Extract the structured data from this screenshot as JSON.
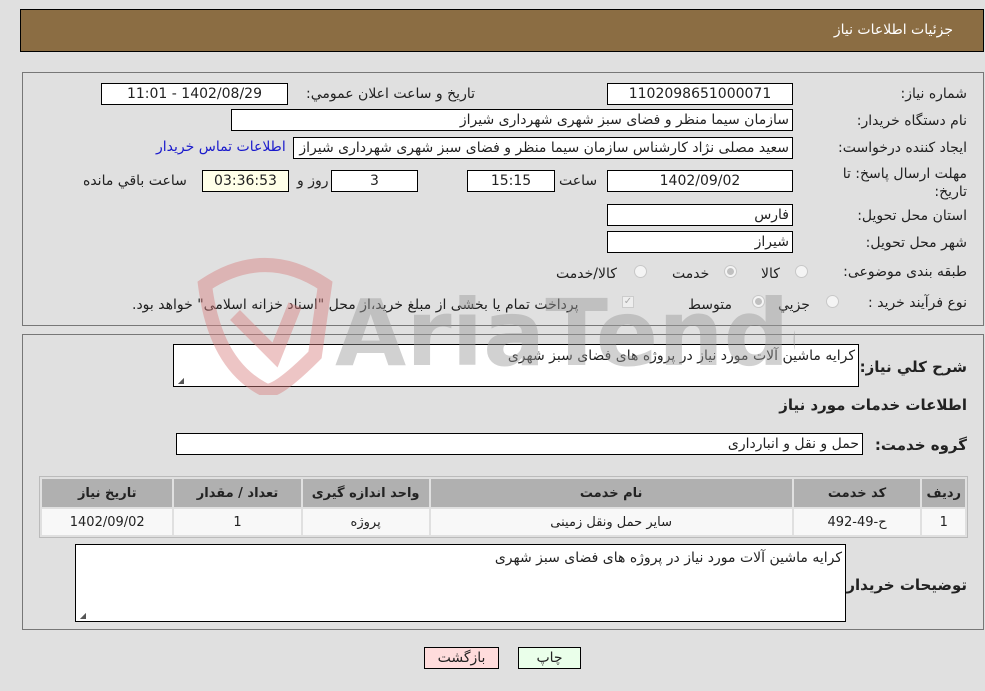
{
  "header": {
    "title": "جزئیات اطلاعات نیاز"
  },
  "form": {
    "need_number": {
      "label": "شماره نیاز:",
      "value": "1102098651000071"
    },
    "announce_datetime": {
      "label": "تاریخ و ساعت اعلان عمومي:",
      "value": "1402/08/29 - 11:01"
    },
    "buyer_org": {
      "label": "نام دستگاه خریدار:",
      "value": "سازمان سیما منظر و فضای سبز شهری شهرداری شیراز"
    },
    "requester": {
      "label": "ایجاد کننده درخواست:",
      "value": "سعید مصلی نژاد کارشناس سازمان سیما منظر و فضای سبز شهری شهرداری شیراز",
      "contact_link": "اطلاعات تماس خریدار"
    },
    "deadline": {
      "label": "مهلت ارسال پاسخ: تا تاریخ:",
      "date": "1402/09/02",
      "time_label": "ساعت",
      "time": "15:15",
      "days": "3",
      "days_label": "روز و",
      "remaining": "03:36:53",
      "remaining_label": "ساعت باقي مانده"
    },
    "province": {
      "label": "استان محل تحویل:",
      "value": "فارس"
    },
    "city": {
      "label": "شهر محل تحویل:",
      "value": "شیراز"
    },
    "category": {
      "label": "طبقه بندی موضوعی:",
      "options": [
        "کالا",
        "خدمت",
        "کالا/خدمت"
      ],
      "selected": "خدمت"
    },
    "purchase_type": {
      "label": "نوع فرآیند خرید :",
      "options": [
        "جزيي",
        "متوسط"
      ],
      "selected": "متوسط",
      "treasury_note": "پرداخت تمام یا بخشی از مبلغ خرید،از محل \"اسناد خزانه اسلامی\" خواهد بود."
    }
  },
  "summary": {
    "label": "شرح کلي نیاز:",
    "value": "کرایه ماشین آلات مورد نیاز در پروژه های فضای سبز شهری"
  },
  "services": {
    "section_title": "اطلاعات خدمات مورد نیاز",
    "group_label": "گروه خدمت:",
    "group_value": "حمل و نقل و انبارداری",
    "table": {
      "headers": [
        "ردیف",
        "کد خدمت",
        "نام خدمت",
        "واحد اندازه گیری",
        "تعداد / مقدار",
        "تاریخ نیاز"
      ],
      "rows": [
        [
          "1",
          "ح-49-492",
          "سایر حمل ونقل زمینی",
          "پروژه",
          "1",
          "1402/09/02"
        ]
      ]
    }
  },
  "buyer_notes": {
    "label": "توضیحات خریدار:",
    "value": "کرایه ماشین آلات مورد نیاز در پروژه های فضای سبز شهری"
  },
  "buttons": {
    "print": "چاپ",
    "back": "بازگشت"
  },
  "watermark": {
    "text": "AriaTender.neT"
  },
  "colors": {
    "header_bg": "#8b6d43",
    "print_bg": "#eaffea",
    "back_bg": "#ffdcdc",
    "link": "#1a1acc"
  }
}
